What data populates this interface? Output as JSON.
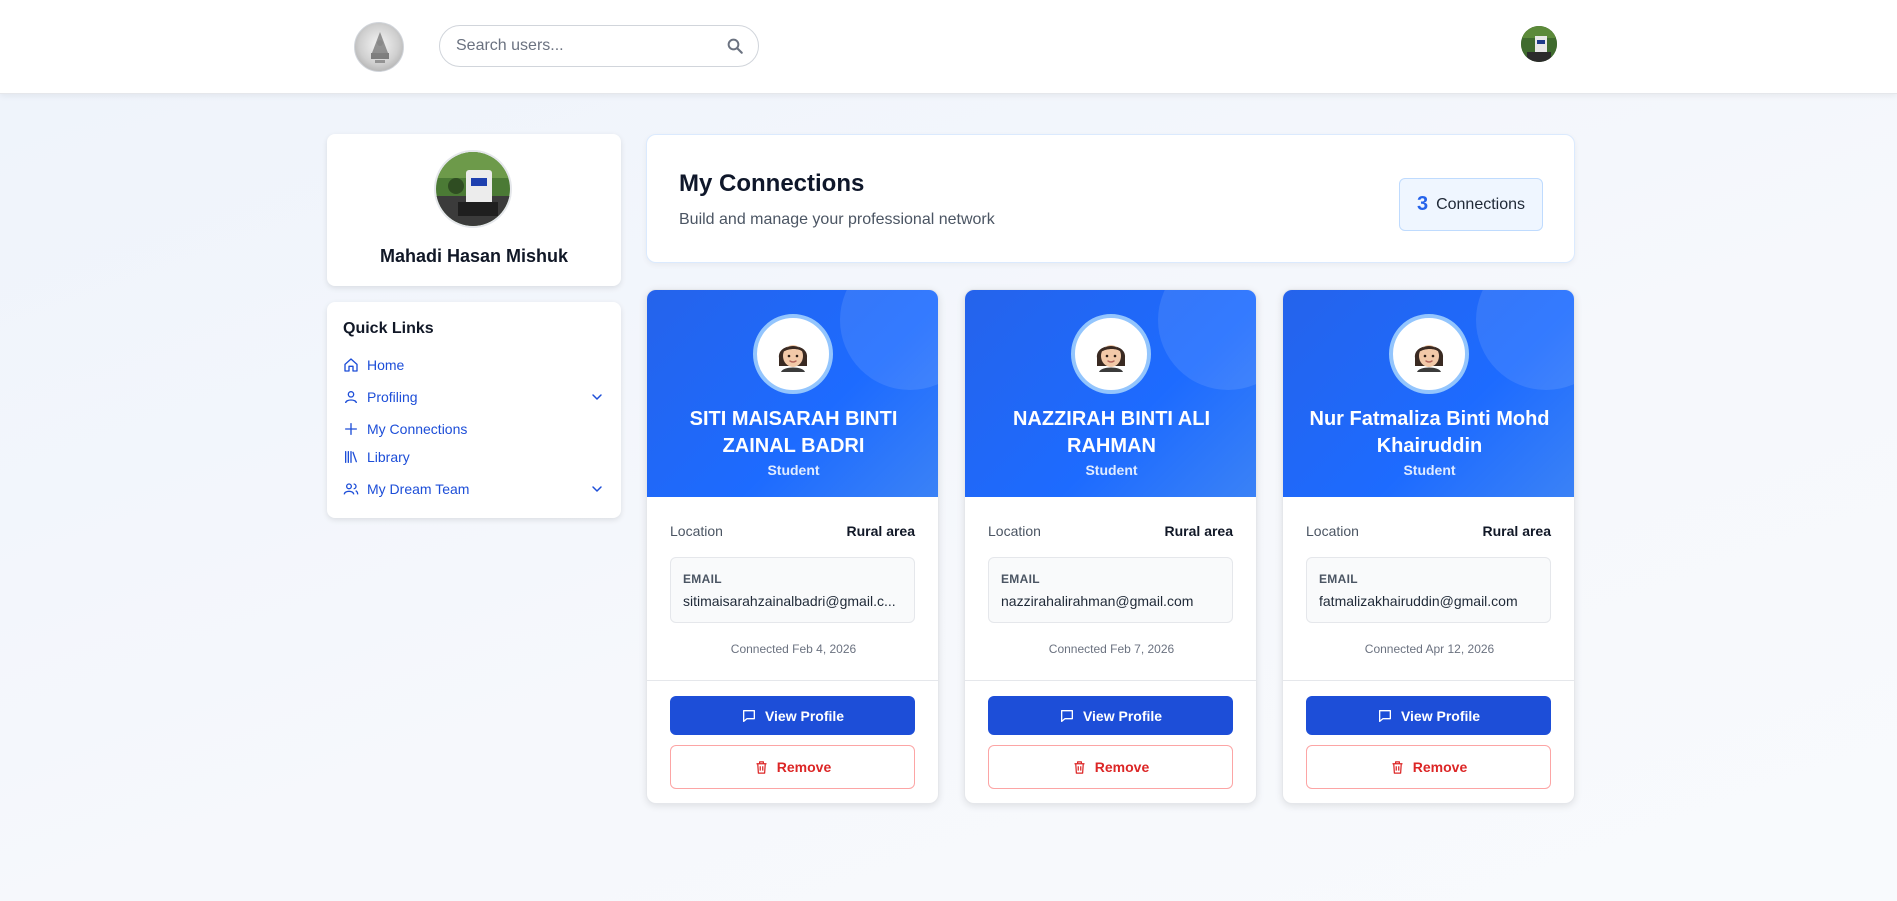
{
  "search": {
    "placeholder": "Search users..."
  },
  "profile": {
    "name": "Mahadi Hasan Mishuk"
  },
  "quick_links": {
    "title": "Quick Links",
    "items": [
      {
        "label": "Home",
        "icon": "home-icon",
        "expandable": false
      },
      {
        "label": "Profiling",
        "icon": "user-icon",
        "expandable": true
      },
      {
        "label": "My Connections",
        "icon": "plus-icon",
        "expandable": false
      },
      {
        "label": "Library",
        "icon": "library-icon",
        "expandable": false
      },
      {
        "label": "My Dream Team",
        "icon": "users-icon",
        "expandable": true
      }
    ]
  },
  "header": {
    "title": "My Connections",
    "subtitle": "Build and manage your professional network",
    "count": "3",
    "count_label": "Connections"
  },
  "connections": [
    {
      "name": "SITI MAISARAH BINTI ZAINAL BADRI",
      "role": "Student",
      "location_label": "Location",
      "location": "Rural area",
      "email_label": "EMAIL",
      "email": "sitimaisarahzainalbadri@gmail.c...",
      "connected": "Connected Feb 4, 2026",
      "view_label": "View Profile",
      "remove_label": "Remove"
    },
    {
      "name": "NAZZIRAH BINTI ALI RAHMAN",
      "role": "Student",
      "location_label": "Location",
      "location": "Rural area",
      "email_label": "EMAIL",
      "email": "nazzirahalirahman@gmail.com",
      "connected": "Connected Feb 7, 2026",
      "view_label": "View Profile",
      "remove_label": "Remove"
    },
    {
      "name": "Nur Fatmaliza Binti Mohd Khairuddin",
      "role": "Student",
      "location_label": "Location",
      "location": "Rural area",
      "email_label": "EMAIL",
      "email": "fatmalizakhairuddin@gmail.com",
      "connected": "Connected Apr 12, 2026",
      "view_label": "View Profile",
      "remove_label": "Remove"
    }
  ],
  "colors": {
    "accent": "#1d4ed8",
    "card_header": "#2563eb",
    "danger": "#dc2626"
  }
}
